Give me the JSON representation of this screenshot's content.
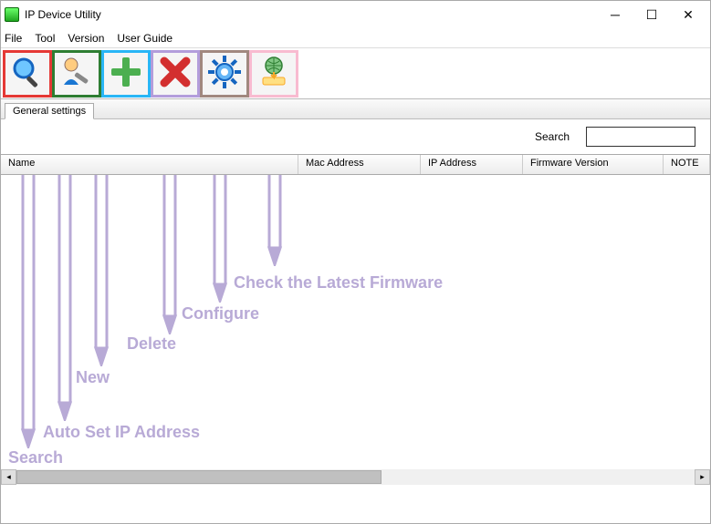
{
  "window": {
    "title": "IP Device Utility"
  },
  "menu": {
    "file": "File",
    "tool": "Tool",
    "version": "Version",
    "user_guide": "User Guide"
  },
  "toolbar": {
    "search_icon": "search",
    "autoset_icon": "autoset",
    "new_icon": "new",
    "delete_icon": "delete",
    "configure_icon": "configure",
    "firmware_icon": "firmware"
  },
  "tabs": {
    "general": "General settings"
  },
  "search": {
    "label": "Search",
    "value": ""
  },
  "grid": {
    "columns": {
      "name": "Name",
      "mac": "Mac Address",
      "ip": "IP Address",
      "fw": "Firmware Version",
      "note": "NOTE"
    },
    "rows": []
  },
  "annotations": {
    "search": "Search",
    "autoset": "Auto Set IP Address",
    "new": "New",
    "delete": "Delete",
    "configure": "Configure",
    "firmware": "Check the Latest Firmware"
  }
}
